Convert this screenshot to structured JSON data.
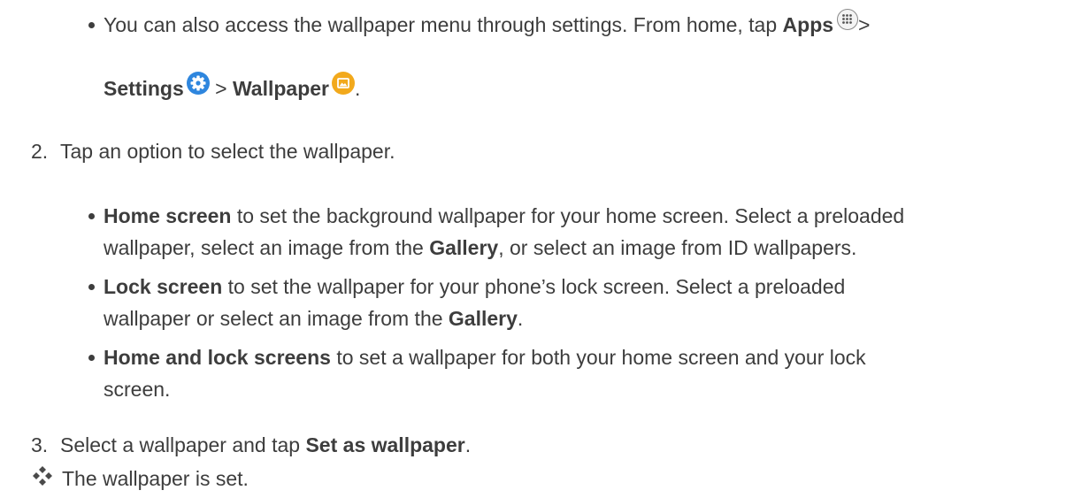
{
  "intro_bullet": {
    "part1": "You can also access the wallpaper menu through settings. From home, tap ",
    "apps": "Apps",
    "sep1": ">",
    "settings": "Settings",
    "sep2": " > ",
    "wallpaper": "Wallpaper",
    "end": "."
  },
  "steps": [
    {
      "number": "2.",
      "text": "Tap an option to select the wallpaper."
    },
    {
      "number": "3.",
      "pre": "Select a wallpaper and tap ",
      "bold": "Set as wallpaper",
      "post": "."
    }
  ],
  "options": [
    {
      "bold": "Home screen",
      "line1": " to set the background wallpaper for your home screen. Select a preloaded",
      "line2_pre": "wallpaper, select an image from the ",
      "line2_bold": "Gallery",
      "line2_post": ", or select an image from ID wallpapers."
    },
    {
      "bold": "Lock screen",
      "line1": " to set the wallpaper for your phone’s lock screen. Select a preloaded",
      "line2_pre": "wallpaper or select an image from the ",
      "line2_bold": "Gallery",
      "line2_post": "."
    },
    {
      "bold": "Home and lock screens",
      "line1": " to set a wallpaper for both your home screen and your lock",
      "line2": "screen."
    }
  ],
  "result": {
    "icon": "four-diamond-icon",
    "text": "The wallpaper is set."
  },
  "colors": {
    "text": "#3d3d3d",
    "settings_icon": "#2e86de",
    "wallpaper_icon": "#f2a91c"
  },
  "icons": {
    "apps": "apps-grid-icon",
    "settings": "gear-icon",
    "wallpaper": "image-icon"
  }
}
